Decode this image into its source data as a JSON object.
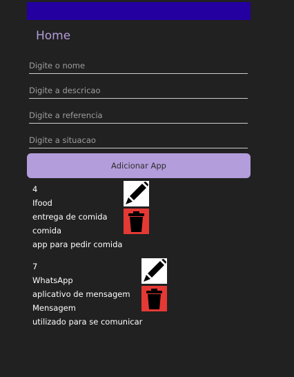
{
  "header": {
    "title": "Home"
  },
  "form": {
    "fields": [
      {
        "name": "nome",
        "placeholder": "Digite o nome",
        "value": ""
      },
      {
        "name": "descricao",
        "placeholder": "Digite a descricao",
        "value": ""
      },
      {
        "name": "referencia",
        "placeholder": "Digite a referencia",
        "value": ""
      },
      {
        "name": "situacao",
        "placeholder": "Digite a situacao",
        "value": ""
      }
    ],
    "submit_label": "Adicionar App"
  },
  "items": [
    {
      "id": "4",
      "nome": "Ifood",
      "descricao": "entrega de comida",
      "referencia": "comida",
      "situacao": "app para pedir comida"
    },
    {
      "id": "7",
      "nome": "WhatsApp",
      "descricao": "aplicativo de mensagem",
      "referencia": "Mensagem",
      "situacao": "utilizado para se comunicar"
    }
  ],
  "icons": {
    "edit": "pencil-icon",
    "delete": "trash-icon"
  },
  "colors": {
    "app_bar": "#2400a0",
    "accent": "#b39ddb",
    "background": "#212121",
    "delete_bg": "#e53935"
  }
}
